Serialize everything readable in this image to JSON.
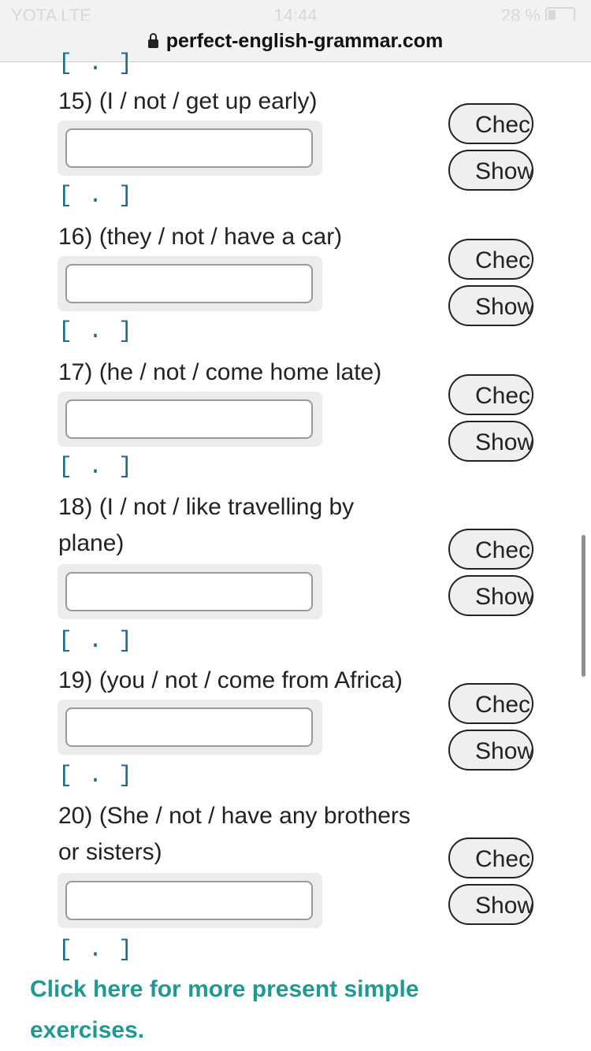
{
  "status": {
    "carrier": "YOTA  LTE",
    "time": "14:44",
    "battery": "28 %"
  },
  "urlbar": {
    "domain": "perfect-english-grammar.com"
  },
  "bracket_text": "[ . ]",
  "questions": [
    {
      "label": "15) (I / not / get up early)"
    },
    {
      "label": "16) (they / not / have a car)"
    },
    {
      "label": "17) (he / not / come home late)"
    },
    {
      "label": "18) (I / not / like travelling by plane)"
    },
    {
      "label": "19) (you / not / come from Africa)"
    },
    {
      "label": "20) (She / not / have any brothers or sisters)"
    }
  ],
  "buttons": {
    "check": "Check",
    "show": "Show"
  },
  "footer": {
    "link": "Click here for more present simple exercises."
  }
}
